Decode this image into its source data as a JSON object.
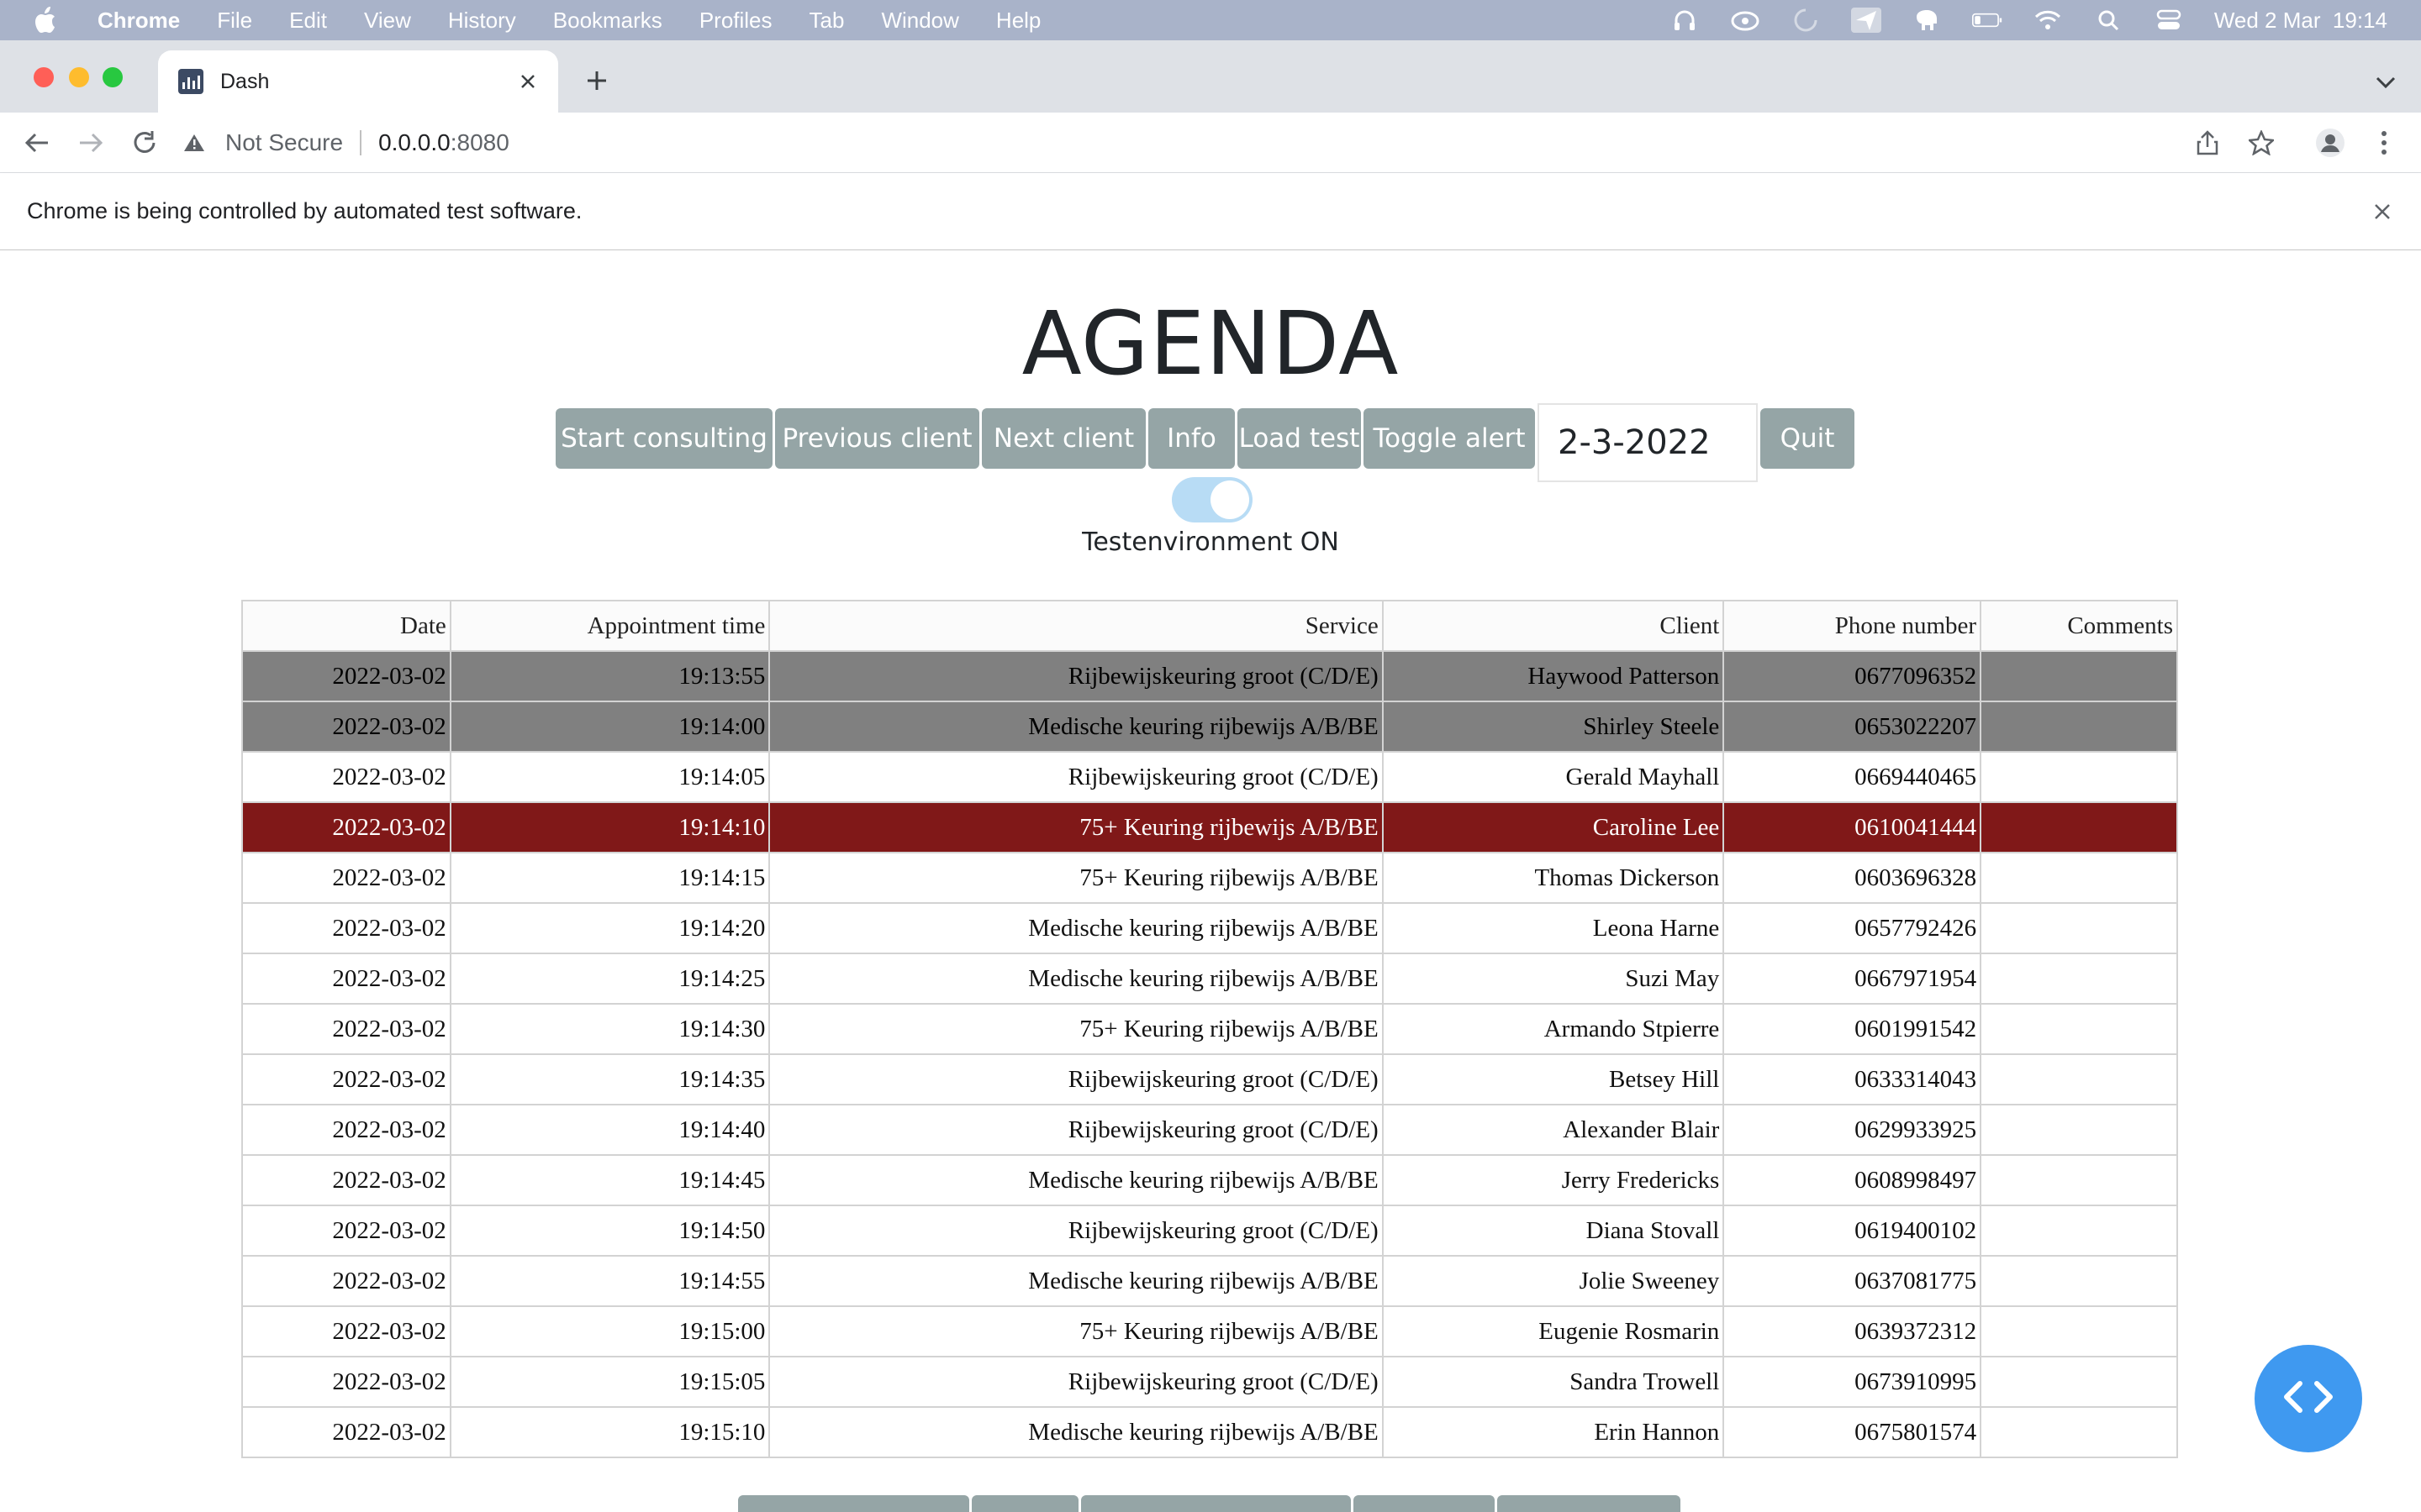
{
  "menubar": {
    "app": "Chrome",
    "items": [
      "File",
      "Edit",
      "View",
      "History",
      "Bookmarks",
      "Profiles",
      "Tab",
      "Window",
      "Help"
    ],
    "clock": "Wed 2 Mar  19:14"
  },
  "browser": {
    "tab_title": "Dash",
    "security_label": "Not Secure",
    "url_host": "0.0.0.0",
    "url_port": ":8080",
    "infobar_text": "Chrome is being controlled by automated test software."
  },
  "page": {
    "title": "AGENDA",
    "buttons": {
      "start": "Start consulting",
      "previous": "Previous client",
      "next": "Next client",
      "info": "Info",
      "load_test": "Load test",
      "toggle_alert": "Toggle alert",
      "quit": "Quit"
    },
    "date_value": "2-3-2022",
    "test_env_label": "Testenvironment ON",
    "test_env_on": true
  },
  "table": {
    "columns": [
      "Date",
      "Appointment time",
      "Service",
      "Client",
      "Phone number",
      "Comments"
    ],
    "rows": [
      {
        "status": "done",
        "cells": [
          "2022-03-02",
          "19:13:55",
          "Rijbewijskeuring groot (C/D/E)",
          "Haywood Patterson",
          "0677096352",
          ""
        ]
      },
      {
        "status": "done",
        "cells": [
          "2022-03-02",
          "19:14:00",
          "Medische keuring rijbewijs A/B/BE",
          "Shirley Steele",
          "0653022207",
          ""
        ]
      },
      {
        "status": "",
        "cells": [
          "2022-03-02",
          "19:14:05",
          "Rijbewijskeuring groot (C/D/E)",
          "Gerald Mayhall",
          "0669440465",
          ""
        ]
      },
      {
        "status": "current",
        "cells": [
          "2022-03-02",
          "19:14:10",
          "75+ Keuring rijbewijs A/B/BE",
          "Caroline Lee",
          "0610041444",
          ""
        ]
      },
      {
        "status": "",
        "cells": [
          "2022-03-02",
          "19:14:15",
          "75+ Keuring rijbewijs A/B/BE",
          "Thomas Dickerson",
          "0603696328",
          ""
        ]
      },
      {
        "status": "",
        "cells": [
          "2022-03-02",
          "19:14:20",
          "Medische keuring rijbewijs A/B/BE",
          "Leona Harne",
          "0657792426",
          ""
        ]
      },
      {
        "status": "",
        "cells": [
          "2022-03-02",
          "19:14:25",
          "Medische keuring rijbewijs A/B/BE",
          "Suzi May",
          "0667971954",
          ""
        ]
      },
      {
        "status": "",
        "cells": [
          "2022-03-02",
          "19:14:30",
          "75+ Keuring rijbewijs A/B/BE",
          "Armando Stpierre",
          "0601991542",
          ""
        ]
      },
      {
        "status": "",
        "cells": [
          "2022-03-02",
          "19:14:35",
          "Rijbewijskeuring groot (C/D/E)",
          "Betsey Hill",
          "0633314043",
          ""
        ]
      },
      {
        "status": "",
        "cells": [
          "2022-03-02",
          "19:14:40",
          "Rijbewijskeuring groot (C/D/E)",
          "Alexander Blair",
          "0629933925",
          ""
        ]
      },
      {
        "status": "",
        "cells": [
          "2022-03-02",
          "19:14:45",
          "Medische keuring rijbewijs A/B/BE",
          "Jerry Fredericks",
          "0608998497",
          ""
        ]
      },
      {
        "status": "",
        "cells": [
          "2022-03-02",
          "19:14:50",
          "Rijbewijskeuring groot (C/D/E)",
          "Diana Stovall",
          "0619400102",
          ""
        ]
      },
      {
        "status": "",
        "cells": [
          "2022-03-02",
          "19:14:55",
          "Medische keuring rijbewijs A/B/BE",
          "Jolie Sweeney",
          "0637081775",
          ""
        ]
      },
      {
        "status": "",
        "cells": [
          "2022-03-02",
          "19:15:00",
          "75+ Keuring rijbewijs A/B/BE",
          "Eugenie Rosmarin",
          "0639372312",
          ""
        ]
      },
      {
        "status": "",
        "cells": [
          "2022-03-02",
          "19:15:05",
          "Rijbewijskeuring groot (C/D/E)",
          "Sandra Trowell",
          "0673910995",
          ""
        ]
      },
      {
        "status": "",
        "cells": [
          "2022-03-02",
          "19:15:10",
          "Medische keuring rijbewijs A/B/BE",
          "Erin Hannon",
          "0675801574",
          ""
        ]
      }
    ]
  },
  "colors": {
    "button": "#95a5a6",
    "row_done": "#808080",
    "row_current": "#801818",
    "fab": "#3f99f0",
    "toggle_on": "#b8dcf5"
  },
  "icons": {
    "fab": "code-icon"
  }
}
